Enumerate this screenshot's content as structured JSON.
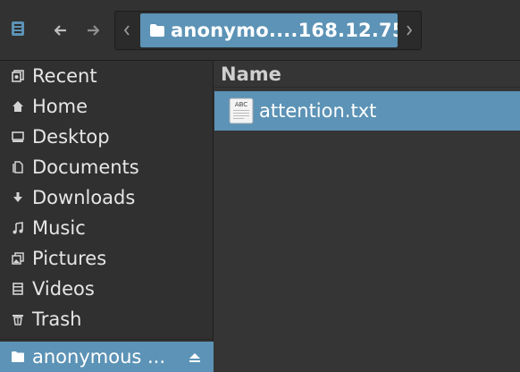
{
  "header": {
    "sidebar_toggle_icon": "sidebar-icon",
    "back_icon": "arrow-left-icon",
    "forward_icon": "arrow-right-icon",
    "path": {
      "crumb_label": "anonymo....168.12.75",
      "crumb_icon": "folder-icon"
    }
  },
  "sidebar": {
    "places": [
      {
        "label": "Recent",
        "icon": "recent-icon"
      },
      {
        "label": "Home",
        "icon": "home-icon"
      },
      {
        "label": "Desktop",
        "icon": "desktop-icon"
      },
      {
        "label": "Documents",
        "icon": "documents-icon"
      },
      {
        "label": "Downloads",
        "icon": "download-icon"
      },
      {
        "label": "Music",
        "icon": "music-icon"
      },
      {
        "label": "Pictures",
        "icon": "pictures-icon"
      },
      {
        "label": "Videos",
        "icon": "videos-icon"
      },
      {
        "label": "Trash",
        "icon": "trash-icon"
      }
    ],
    "mount": {
      "label": "anonymous ...",
      "icon": "folder-icon",
      "eject_icon": "eject-icon"
    }
  },
  "main": {
    "column_header": "Name",
    "files": [
      {
        "name": "attention.txt",
        "icon": "text-file-icon",
        "icon_text": "ABC"
      }
    ]
  },
  "colors": {
    "accent": "#5c93b6",
    "background": "#353535",
    "sidebar": "#303030"
  }
}
